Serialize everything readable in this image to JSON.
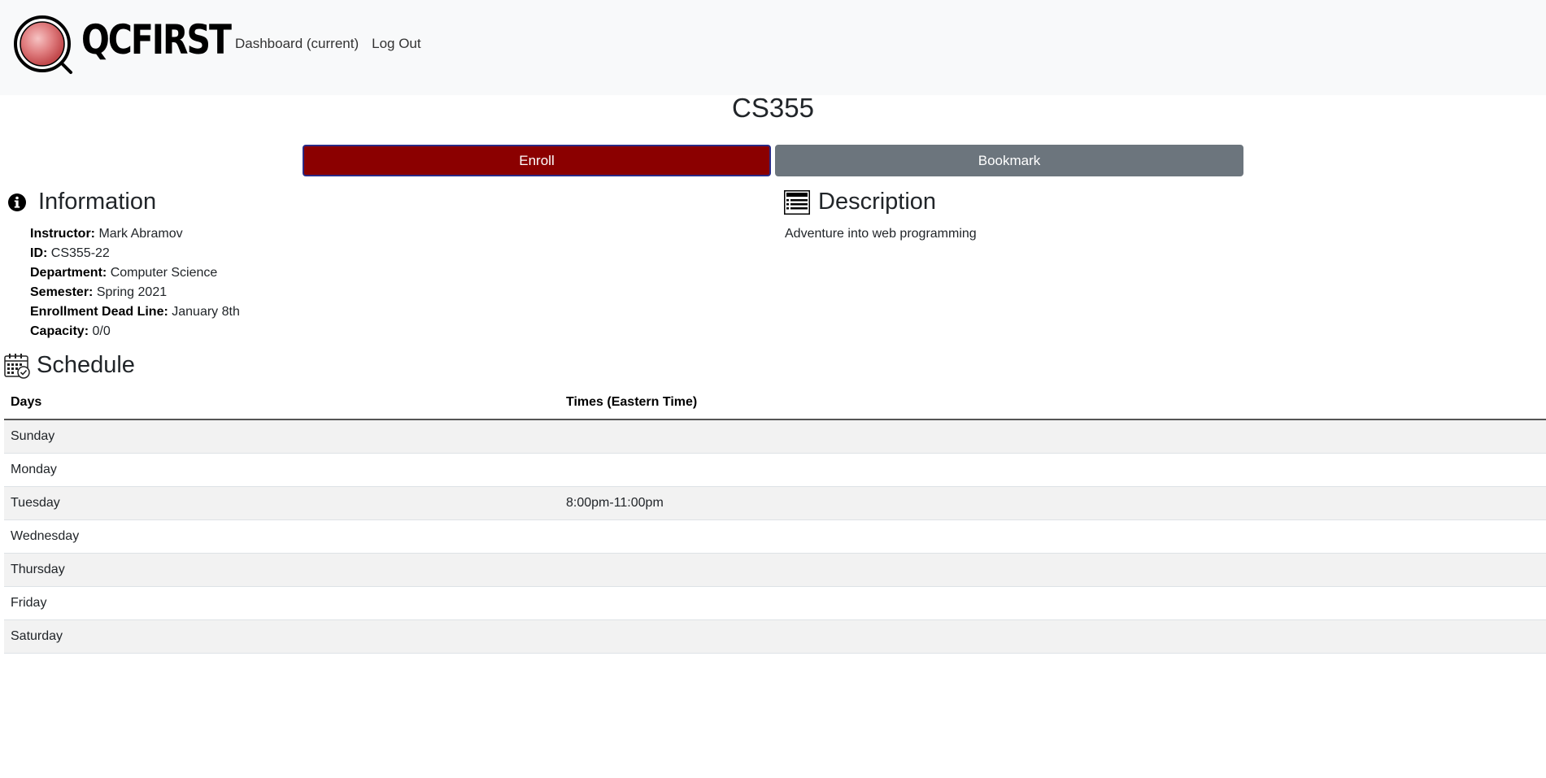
{
  "brand": {
    "name": "QCFIRST"
  },
  "nav": {
    "dashboard_label": "Dashboard (current)",
    "logout_label": "Log Out"
  },
  "course": {
    "code": "CS355"
  },
  "actions": {
    "enroll_label": "Enroll",
    "bookmark_label": "Bookmark",
    "enroll_color": "#8b0000",
    "bookmark_color": "#6c757d"
  },
  "information": {
    "heading": "Information",
    "fields": [
      {
        "label": "Instructor:",
        "value": "Mark Abramov"
      },
      {
        "label": "ID:",
        "value": "CS355-22"
      },
      {
        "label": "Department:",
        "value": "Computer Science"
      },
      {
        "label": "Semester:",
        "value": "Spring 2021"
      },
      {
        "label": "Enrollment Dead Line:",
        "value": "January 8th"
      },
      {
        "label": "Capacity:",
        "value": "0/0"
      }
    ]
  },
  "description": {
    "heading": "Description",
    "text": "Adventure into web programming"
  },
  "schedule": {
    "heading": "Schedule",
    "columns": [
      "Days",
      "Times (Eastern Time)"
    ],
    "rows": [
      {
        "day": "Sunday",
        "time": ""
      },
      {
        "day": "Monday",
        "time": ""
      },
      {
        "day": "Tuesday",
        "time": "8:00pm-11:00pm"
      },
      {
        "day": "Wednesday",
        "time": ""
      },
      {
        "day": "Thursday",
        "time": ""
      },
      {
        "day": "Friday",
        "time": ""
      },
      {
        "day": "Saturday",
        "time": ""
      }
    ]
  },
  "icons": {
    "logo": "magnifier-logo-icon",
    "information": "info-circle-icon",
    "description": "list-icon",
    "schedule": "calendar-check-icon"
  }
}
